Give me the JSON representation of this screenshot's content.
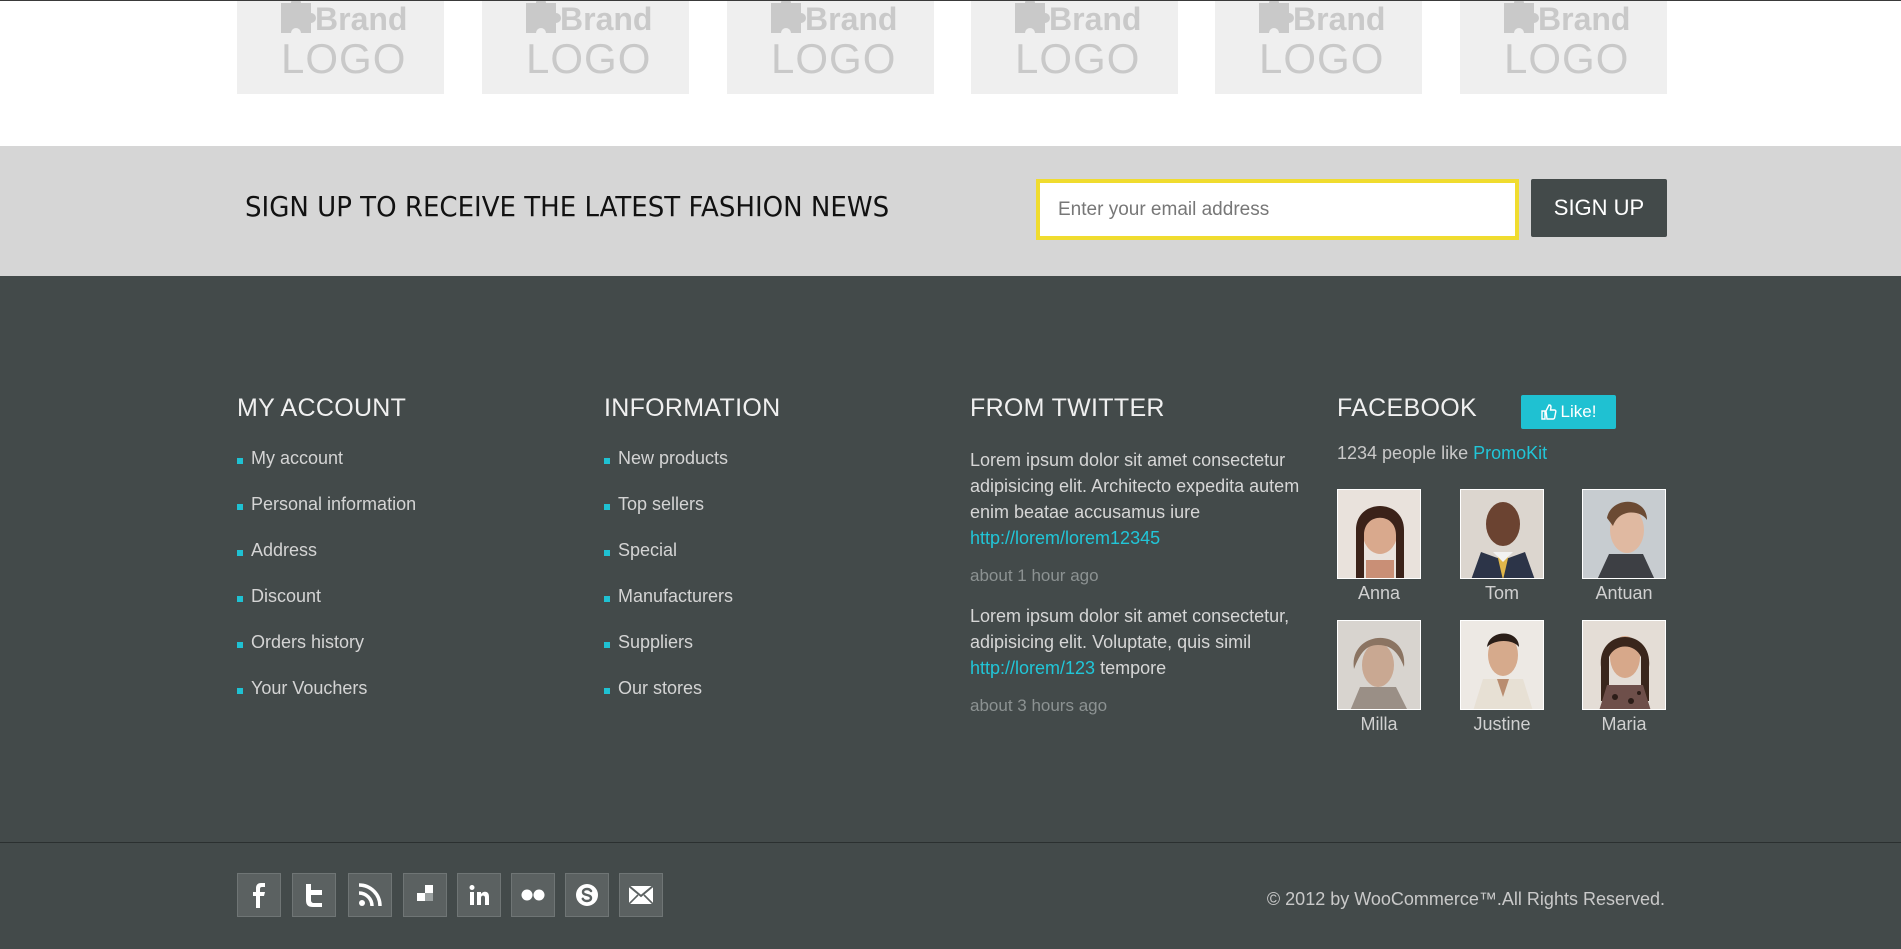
{
  "brands": {
    "items": [
      {
        "word": "Brand",
        "logo": "LOGO"
      },
      {
        "word": "Brand",
        "logo": "LOGO"
      },
      {
        "word": "Brand",
        "logo": "LOGO"
      },
      {
        "word": "Brand",
        "logo": "LOGO"
      },
      {
        "word": "Brand",
        "logo": "LOGO"
      },
      {
        "word": "Brand",
        "logo": "LOGO"
      }
    ]
  },
  "newsletter": {
    "heading": "SIGN UP TO RECEIVE THE LATEST FASHION NEWS",
    "email_placeholder": "Enter your email address",
    "button_label": "SIGN UP",
    "input_border_color": "#f0dc2f"
  },
  "my_account": {
    "title": "MY ACCOUNT",
    "items": [
      "My account",
      "Personal information",
      "Address",
      "Discount",
      "Orders history",
      "Your Vouchers"
    ]
  },
  "information": {
    "title": "INFORMATION",
    "items": [
      "New products",
      "Top sellers",
      "Special",
      "Manufacturers",
      "Suppliers",
      "Our stores"
    ]
  },
  "twitter": {
    "title": "FROM TWITTER",
    "tweets": [
      {
        "text": "Lorem ipsum dolor sit amet consectetur adipisicing elit. Architecto expedita autem enim beatae accusamus iure",
        "link": "http://lorem/lorem12345",
        "after": "",
        "time": "about 1 hour ago"
      },
      {
        "text": "Lorem ipsum dolor sit amet consectetur, adipisicing elit. Voluptate, quis simil",
        "link": "http://lorem/123",
        "after": " tempore",
        "time": "about 3 hours ago"
      }
    ]
  },
  "facebook": {
    "title": "FACEBOOK",
    "like_label": "Like!",
    "count_text": "1234 people like ",
    "page_name": "PromoKit",
    "friends": [
      "Anna",
      "Tom",
      "Antuan",
      "Milla",
      "Justine",
      "Maria"
    ]
  },
  "footer_bottom": {
    "social_icons": [
      "facebook-icon",
      "twitter-icon",
      "rss-icon",
      "delicious-icon",
      "linkedin-icon",
      "flickr-icon",
      "skype-icon",
      "email-icon"
    ],
    "copyright": "© 2012 by WooCommerce™.All Rights Reserved."
  },
  "colors": {
    "accent": "#1fc1d2",
    "footer_bg": "#434a4a",
    "newsletter_bg": "#d6d6d6"
  }
}
